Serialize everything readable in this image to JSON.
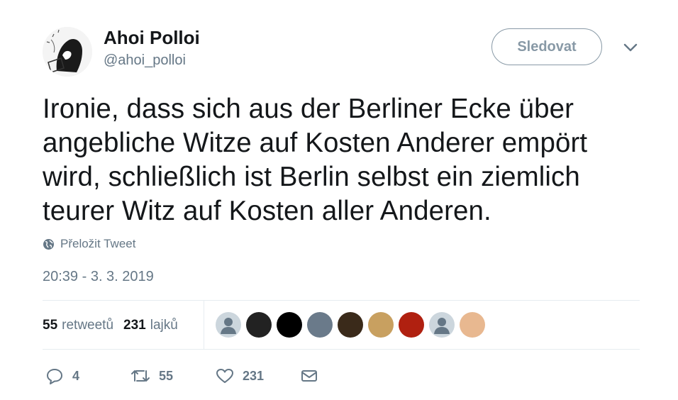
{
  "author": {
    "name": "Ahoi Polloi",
    "handle": "@ahoi_polloi"
  },
  "follow_button": {
    "label": "Sledovat"
  },
  "tweet": {
    "text": "Ironie, dass sich aus der Berliner Ecke über angebliche Witze auf Kosten Anderer empört wird, schließlich ist Berlin selbst ein ziemlich teurer Witz auf Kosten aller Anderen.",
    "translate_label": "Přeložit Tweet",
    "timestamp": "20:39 - 3. 3. 2019"
  },
  "stats": {
    "retweets_count": "55",
    "retweets_label": "retweetů",
    "likes_count": "231",
    "likes_label": "lajků"
  },
  "likers": [
    {
      "icon": "default-avatar",
      "color": "#ccd6dd"
    },
    {
      "icon": "mustache-face-avatar",
      "color": "#222222"
    },
    {
      "icon": "black-circle-avatar",
      "color": "#000000"
    },
    {
      "icon": "sunglasses-man-avatar",
      "color": "#6a7a8a"
    },
    {
      "icon": "teddy-bear-avatar",
      "color": "#3a2a1a"
    },
    {
      "icon": "blonde-woman-avatar",
      "color": "#c8a060"
    },
    {
      "icon": "red-devil-avatar",
      "color": "#b02010"
    },
    {
      "icon": "default-avatar",
      "color": "#ccd6dd"
    },
    {
      "icon": "cartoon-girl-avatar",
      "color": "#e8b890"
    }
  ],
  "actions": {
    "reply_count": "4",
    "retweet_count": "55",
    "like_count": "231"
  },
  "colors": {
    "secondary_text": "#657786",
    "primary_text": "#14171a",
    "divider": "#e6ecf0"
  }
}
